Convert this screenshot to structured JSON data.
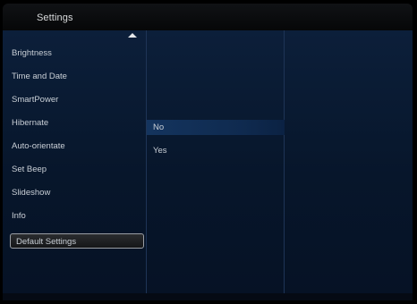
{
  "header": {
    "title": "Settings"
  },
  "menu": {
    "items": [
      {
        "label": "Brightness"
      },
      {
        "label": "Time and Date"
      },
      {
        "label": "SmartPower"
      },
      {
        "label": "Hibernate"
      },
      {
        "label": "Auto-orientate"
      },
      {
        "label": "Set Beep"
      },
      {
        "label": "Slideshow"
      },
      {
        "label": "Info"
      },
      {
        "label": "Default Settings"
      }
    ],
    "selected_label": "Default Settings"
  },
  "options": {
    "items": [
      {
        "label": "No"
      },
      {
        "label": "Yes"
      }
    ],
    "highlighted_label": "No"
  },
  "icons": {
    "scroll_up": "up-triangle-icon"
  },
  "colors": {
    "background": "#07162b",
    "highlight": "#14345e",
    "text": "#c9cfd6"
  }
}
